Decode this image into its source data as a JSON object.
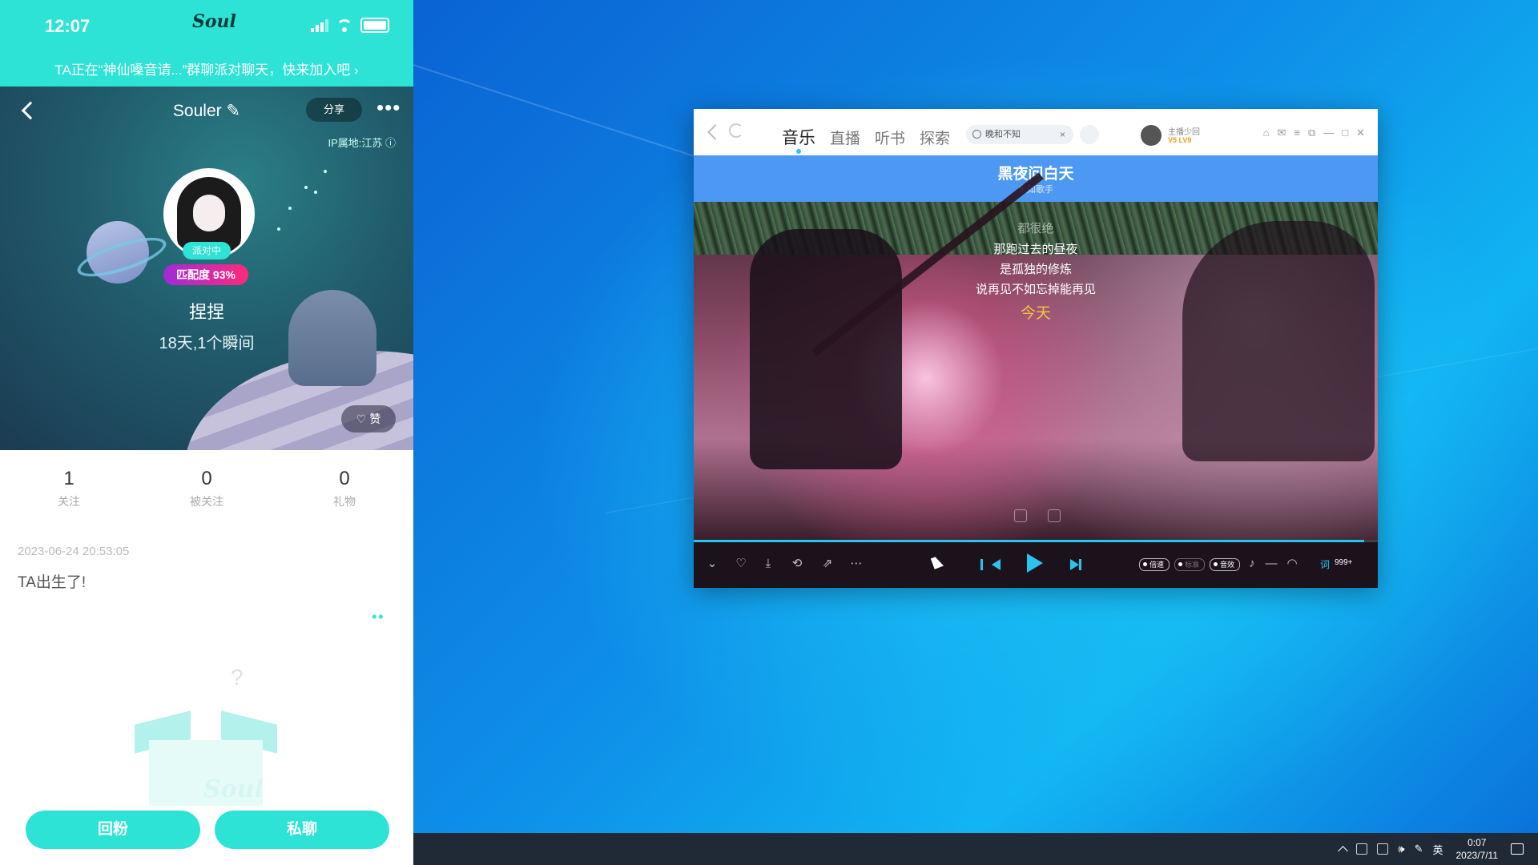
{
  "phone": {
    "status": {
      "time": "12:07",
      "app_name": "Soul"
    },
    "banner": {
      "text": "TA正在“神仙嗓音请...”群聊派对聊天，快来加入吧 ›"
    },
    "header": {
      "title": "Souler ✎",
      "share_label": "分享",
      "more_label": "•••",
      "ip_location": "IP属地:江苏 ⓘ"
    },
    "profile": {
      "party_badge": "派对中",
      "match_badge": "匹配度 93%",
      "nickname": "捏捏",
      "age_info": "18天,1个瞬间",
      "like_label": "赞"
    },
    "stats": [
      {
        "value": "1",
        "label": "关注"
      },
      {
        "value": "0",
        "label": "被关注"
      },
      {
        "value": "0",
        "label": "礼物"
      }
    ],
    "post": {
      "date": "2023-06-24 20:53:05",
      "text": "TA出生了!",
      "more": "••"
    },
    "empty_state": {
      "question": "?",
      "watermark": "Soul"
    },
    "actions": {
      "follow_back": "回粉",
      "private_chat": "私聊"
    }
  },
  "player": {
    "tabs": [
      {
        "label": "音乐",
        "active": true
      },
      {
        "label": "直播",
        "active": false
      },
      {
        "label": "听书",
        "active": false
      },
      {
        "label": "探索",
        "active": false
      }
    ],
    "search": {
      "value": "晚和不知",
      "clear": "×"
    },
    "user": {
      "name": "主播少回",
      "vip": "V5 LV9"
    },
    "window_controls": {
      "skin": "⌂",
      "mail": "✉",
      "menu": "≡",
      "mini": "⧉",
      "minimize": "—",
      "maximize": "□",
      "close": "✕"
    },
    "now_playing": {
      "title": "黑夜问白天",
      "artist": "未知歌手"
    },
    "lyrics": [
      {
        "text": "都很绝",
        "state": "faded"
      },
      {
        "text": "那跑过去的昼夜",
        "state": "normal"
      },
      {
        "text": "是孤独的修炼",
        "state": "normal"
      },
      {
        "text": "说再见不如忘掉能再见",
        "state": "normal"
      },
      {
        "text": "今天",
        "state": "current"
      }
    ],
    "progress": 0.98,
    "controls": {
      "collapse": "⌄",
      "like": "♡",
      "download": "⤓",
      "loop": "⟲",
      "share": "⇗",
      "more": "⋯",
      "speed_label": "倍速",
      "quality_label": "标准",
      "effect_label": "音效",
      "volume": "♪",
      "minus": "—",
      "headphone": "◠",
      "lyric_toggle": "词",
      "queue": "999+"
    },
    "accent_color": "#2bc3f0"
  },
  "taskbar": {
    "ime": "英",
    "time": "0:07",
    "date": "2023/7/11"
  }
}
